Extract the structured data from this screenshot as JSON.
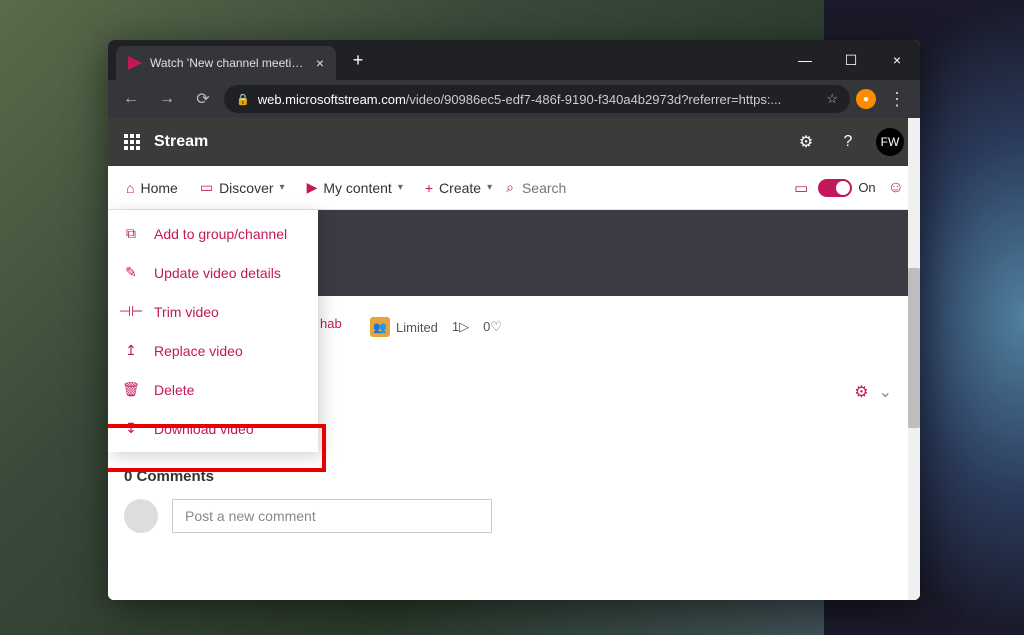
{
  "browser": {
    "tab_title": "Watch 'New channel meeting' | M",
    "url_domain": "web.microsoftstream.com",
    "url_path": "/video/90986ec5-edf7-486f-9190-f340a4b2973d?referrer=https:..."
  },
  "stream_header": {
    "app_title": "Stream",
    "avatar_initials": "FW"
  },
  "toolbar": {
    "home": "Home",
    "discover": "Discover",
    "mycontent": "My content",
    "create": "Create",
    "search_placeholder": "Search",
    "toggle_label": "On"
  },
  "meta": {
    "partial_name": "hab",
    "privacy": "Limited",
    "views": "1",
    "likes": "0"
  },
  "context_menu": {
    "items": [
      {
        "icon": "group-add",
        "label": "Add to group/channel"
      },
      {
        "icon": "pencil",
        "label": "Update video details"
      },
      {
        "icon": "trim",
        "label": "Trim video"
      },
      {
        "icon": "replace",
        "label": "Replace video"
      },
      {
        "icon": "trash",
        "label": "Delete"
      },
      {
        "icon": "download",
        "label": "Download video"
      }
    ]
  },
  "comments": {
    "title": "0 Comments",
    "placeholder": "Post a new comment"
  }
}
